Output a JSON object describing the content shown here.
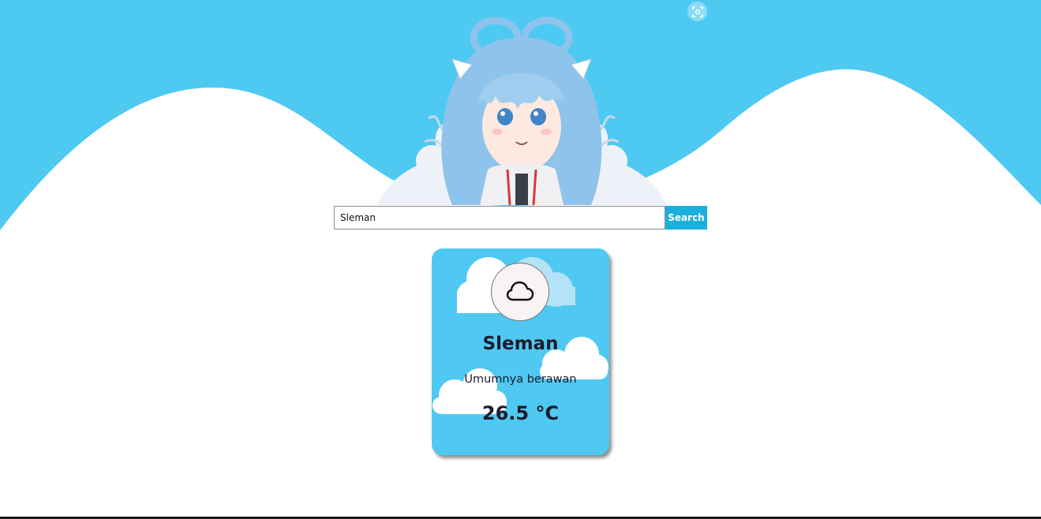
{
  "colors": {
    "sky": "#4ec9f2",
    "button": "#1bb0dc",
    "card": "#4fc9f2"
  },
  "header": {
    "mascot": "anime-girl-illustration",
    "fullscreen_icon": "fullscreen-focus-icon"
  },
  "search": {
    "value": "Sleman",
    "button_label": "Search"
  },
  "weather": {
    "icon": "cloud-icon",
    "city": "Sleman",
    "description": "Umumnya berawan",
    "temperature": "26.5 °C"
  }
}
